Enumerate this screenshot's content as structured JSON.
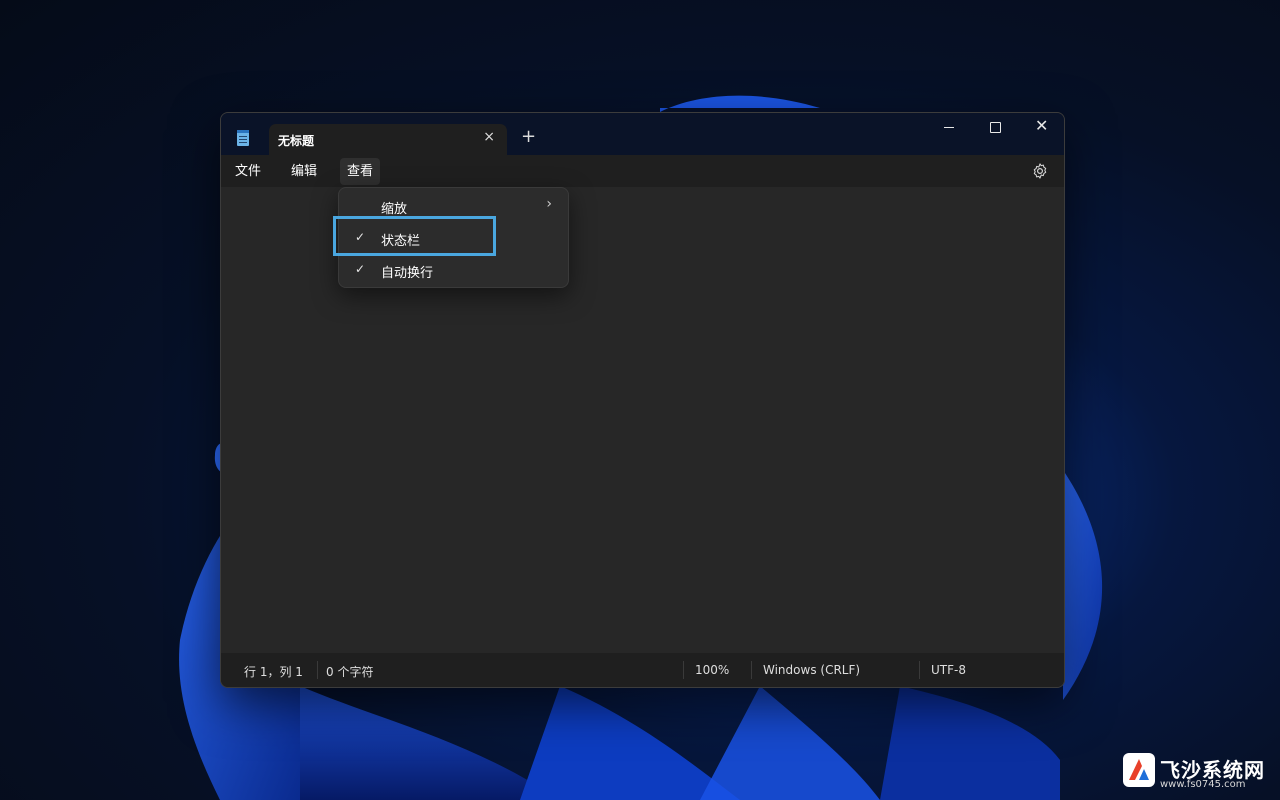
{
  "tab": {
    "title": "无标题",
    "close_icon": "×",
    "new_icon": "+"
  },
  "window_controls": {
    "close_icon": "✕"
  },
  "menu": {
    "file": "文件",
    "edit": "编辑",
    "view": "查看"
  },
  "dropdown": {
    "items": [
      {
        "label": "缩放",
        "check": "",
        "arrow": "›"
      },
      {
        "label": "状态栏",
        "check": "✓",
        "arrow": ""
      },
      {
        "label": "自动换行",
        "check": "✓",
        "arrow": ""
      }
    ]
  },
  "status": {
    "position": "行 1，列 1",
    "chars": "0 个字符",
    "zoom": "100%",
    "line_ending": "Windows (CRLF)",
    "encoding": "UTF-8"
  },
  "watermark": {
    "title": "飞沙系统网",
    "url": "www.fs0745.com"
  },
  "colors": {
    "highlight": "#4aa7e0",
    "titlebar": "#0a1328",
    "editor": "#272727"
  }
}
